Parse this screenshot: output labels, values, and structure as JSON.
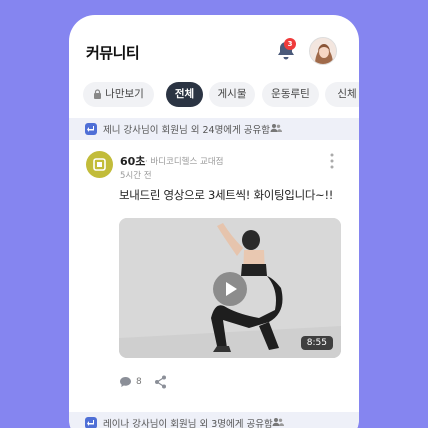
{
  "header": {
    "title": "커뮤니티",
    "notification_count": "3"
  },
  "tabs": [
    {
      "label": "나만보기",
      "icon": "lock-icon"
    },
    {
      "label": "전체"
    },
    {
      "label": "게시물"
    },
    {
      "label": "운동루틴"
    },
    {
      "label": "신체"
    }
  ],
  "shares": [
    {
      "text": "제니 강사님이 회원님 외 24명에게 공유함"
    },
    {
      "text": "레이나 강사님이 회원님 외 3명에게 공유함"
    }
  ],
  "post": {
    "author": "60초",
    "org": "· 바디코디헬스 교대점",
    "time": "5시간 전",
    "body": "보내드린 영상으로 3세트씩! 화이팅입니다~!!",
    "video_duration": "8:55",
    "comment_count": "8"
  },
  "colors": {
    "background": "#8585f0",
    "active_tab": "#2b3443",
    "badge": "#ef3b3b",
    "share_icon": "#4f6fd6"
  }
}
